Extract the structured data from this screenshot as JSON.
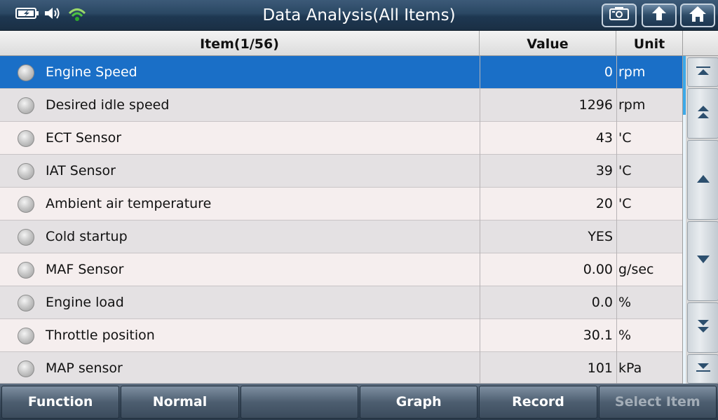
{
  "header": {
    "title": "Data Analysis(All Items)",
    "status_icons": [
      "battery-charging-icon",
      "speaker-icon",
      "wifi-icon"
    ],
    "buttons": [
      "screenshot-icon",
      "back-icon",
      "home-icon"
    ]
  },
  "table": {
    "headers": {
      "item": "Item(1/56)",
      "value": "Value",
      "unit": "Unit"
    },
    "rows": [
      {
        "name": "Engine Speed",
        "value": "0",
        "unit": "rpm",
        "selected": true
      },
      {
        "name": "Desired idle speed",
        "value": "1296",
        "unit": "rpm"
      },
      {
        "name": "ECT Sensor",
        "value": "43",
        "unit": "'C"
      },
      {
        "name": "IAT Sensor",
        "value": "39",
        "unit": "'C"
      },
      {
        "name": "Ambient air temperature",
        "value": "20",
        "unit": "'C"
      },
      {
        "name": "Cold startup",
        "value": "YES",
        "unit": ""
      },
      {
        "name": "MAF Sensor",
        "value": "0.00",
        "unit": "g/sec"
      },
      {
        "name": "Engine load",
        "value": "0.0",
        "unit": "%"
      },
      {
        "name": "Throttle position",
        "value": "30.1",
        "unit": "%"
      },
      {
        "name": "MAP sensor",
        "value": "101",
        "unit": "kPa"
      }
    ]
  },
  "scroll": {
    "buttons": [
      "scroll-top-icon",
      "page-up-icon",
      "line-up-icon",
      "line-down-icon",
      "page-down-icon",
      "scroll-bottom-icon"
    ]
  },
  "footer": {
    "buttons": [
      "Function",
      "Normal",
      "",
      "Graph",
      "Record",
      "Select Item"
    ]
  },
  "colors": {
    "selection": "#1a6fc7",
    "titlebar": "#2a4763",
    "scroll_thumb": "#3da9e8"
  }
}
